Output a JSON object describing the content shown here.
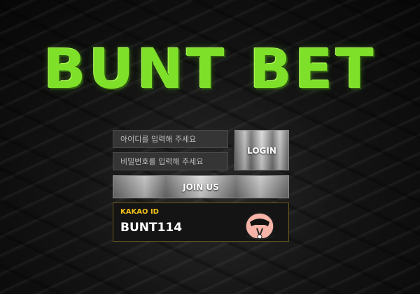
{
  "brand": {
    "logo_text": "BUNT BET"
  },
  "login_form": {
    "id_placeholder": "아이디를 입력해 주세요",
    "password_placeholder": "비밀번호를 입력해 주세요",
    "login_label": "LOGIN",
    "join_label": "JOIN US"
  },
  "kakao": {
    "label": "KAKAO ID",
    "id_value": "BUNT114",
    "mascot_icon": "kakao-apeach-icon"
  },
  "colors": {
    "logo_green": "#7fe02a",
    "kakao_yellow": "#f2c21b",
    "background": "#0b0b0b"
  }
}
